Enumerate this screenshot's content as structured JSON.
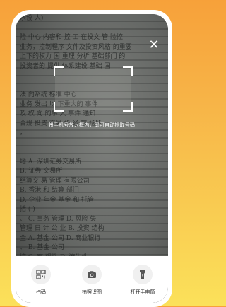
{
  "scan": {
    "hint": "将手机号放入框内，即可自动提取号码"
  },
  "actions": [
    {
      "label": "扫码",
      "icon": "qr-code-icon"
    },
    {
      "label": "拍照识图",
      "icon": "camera-icon"
    },
    {
      "label": "打开手电筒",
      "icon": "flashlight-icon"
    }
  ],
  "close": {
    "icon": "close-icon"
  },
  "colors": {
    "accent": "#f7a13a",
    "overlay": "#2a2d31"
  }
}
